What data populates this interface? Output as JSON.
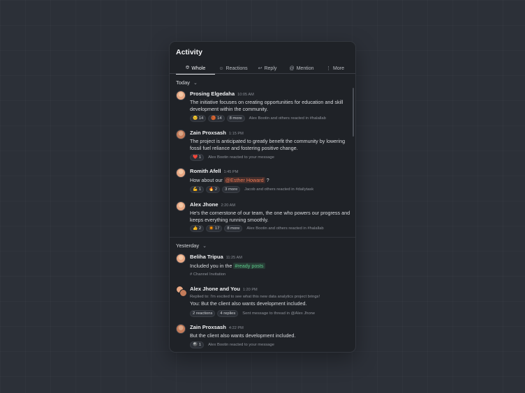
{
  "title": "Activity",
  "tabs": [
    {
      "label": "Whole",
      "icon": "bell-icon"
    },
    {
      "label": "Reactions",
      "icon": "smiley-icon"
    },
    {
      "label": "Reply",
      "icon": "reply-icon"
    },
    {
      "label": "Mention",
      "icon": "at-icon"
    },
    {
      "label": "More",
      "icon": "more-icon"
    }
  ],
  "sections": {
    "today": "Today",
    "yesterday": "Yesterday"
  },
  "items": [
    {
      "name": "Prosing Elgedaha",
      "time": "10:05 AM",
      "text": "The initiative focuses on creating opportunities for education and skill development within the community.",
      "chips": [
        "😊 14",
        "🏀 14",
        "8 more"
      ],
      "meta": "Alex Bootin and others reacted in #halallab"
    },
    {
      "name": "Zain Proxsash",
      "time": "1:15 PM",
      "text": "The project is anticipated to greatly benefit the community by lowering fossil fuel reliance and fostering positive change.",
      "chips": [
        "❤️ 1"
      ],
      "meta": "Alex Bootin reacted to your message"
    },
    {
      "name": "Romith Afell",
      "time": "1:45 PM",
      "text_before": "How about our",
      "mention": "@Esther Howard",
      "text_after": "?",
      "chips": [
        "💪 1",
        "🔥 2",
        "3 more"
      ],
      "meta": "Jacob and others reacted in #dailytask"
    },
    {
      "name": "Alex Jhone",
      "time": "2:20 AM",
      "text": "He's the cornerstone of our team, the one who powers our progress and keeps everything running smoothly.",
      "chips": [
        "👍 2",
        "✴️ 17",
        "8 more"
      ],
      "meta": "Alex Bootin and others reacted in #halallab"
    },
    {
      "name": "Beliha Tripua",
      "time": "11:25 AM",
      "text_before": "Included you in the",
      "tag": "#ready posts",
      "sub": "# Channel Invitation"
    },
    {
      "name": "Alex Jhone and You",
      "time": "1:20 PM",
      "reply": "Replied to: I'm excited to see what this new data analytics project brings!",
      "text": "You: But the client also wants development included.",
      "chips": [
        "2 reactions",
        "4 replies"
      ],
      "meta": "Sent message to thread in @Alex Jhone"
    },
    {
      "name": "Zain Proxsash",
      "time": "4:22 PM",
      "text": "But the client also wants development included.",
      "chips": [
        "🎱 1"
      ],
      "meta": "Alex Bootin reacted to your message"
    }
  ],
  "colors": {
    "background": "#2c3038",
    "panel": "#1f2227",
    "mention": "#f07a55",
    "tag": "#5cc889"
  }
}
